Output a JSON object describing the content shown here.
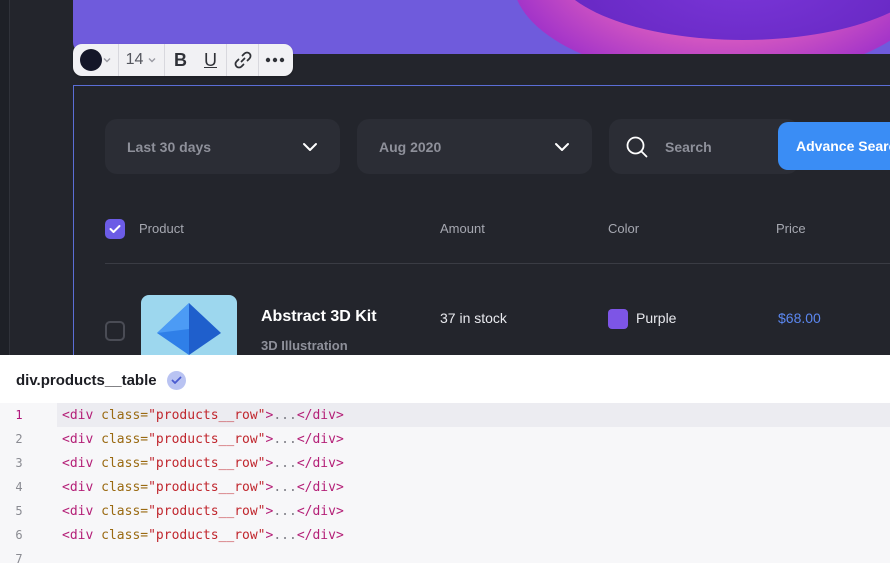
{
  "toolbar": {
    "text_color": "#141628",
    "font_size": "14",
    "bold_label": "B",
    "underline_label": "U"
  },
  "filters": {
    "date_range": "Last 30 days",
    "month": "Aug 2020",
    "search_placeholder": "Search",
    "advance_search_label": "Advance Search"
  },
  "table": {
    "columns": [
      "Product",
      "Amount",
      "Color",
      "Price"
    ],
    "header_checked": true,
    "rows": [
      {
        "checked": false,
        "name": "Abstract 3D Kit",
        "category": "3D Illustration",
        "amount": "37 in stock",
        "color_name": "Purple",
        "color_hex": "#7d55e6",
        "price": "$68.00"
      }
    ]
  },
  "inspector": {
    "selector": "div.products__table",
    "code_lines": [
      {
        "n": "1",
        "tag_open": "<div",
        "attr": " class=",
        "value": "\"products__row\"",
        "close": ">",
        "ellipsis": "...",
        "tag_close": "</div>"
      },
      {
        "n": "2",
        "tag_open": "<div",
        "attr": " class=",
        "value": "\"products__row\"",
        "close": ">",
        "ellipsis": "...",
        "tag_close": "</div>"
      },
      {
        "n": "3",
        "tag_open": "<div",
        "attr": " class=",
        "value": "\"products__row\"",
        "close": ">",
        "ellipsis": "...",
        "tag_close": "</div>"
      },
      {
        "n": "4",
        "tag_open": "<div",
        "attr": " class=",
        "value": "\"products__row\"",
        "close": ">",
        "ellipsis": "...",
        "tag_close": "</div>"
      },
      {
        "n": "5",
        "tag_open": "<div",
        "attr": " class=",
        "value": "\"products__row\"",
        "close": ">",
        "ellipsis": "...",
        "tag_close": "</div>"
      },
      {
        "n": "6",
        "tag_open": "<div",
        "attr": " class=",
        "value": "\"products__row\"",
        "close": ">",
        "ellipsis": "...",
        "tag_close": "</div>"
      },
      {
        "n": "7",
        "tag_open": "",
        "attr": "",
        "value": "",
        "close": "",
        "ellipsis": "",
        "tag_close": ""
      }
    ],
    "active_line": "1"
  },
  "colors": {
    "accent_blue": "#3a8df5",
    "checkbox_purple": "#6c5ce6",
    "price_blue": "#5b87f0",
    "dark_bg": "#23252c"
  }
}
